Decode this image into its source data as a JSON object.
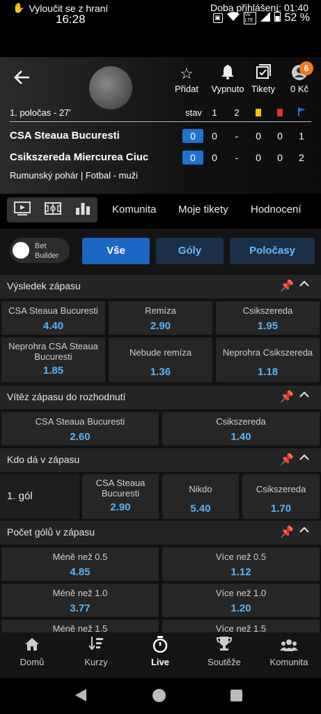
{
  "status_bar": {
    "time": "16:28",
    "battery": "52 %",
    "lte": "Vo LTE"
  },
  "info_bar": {
    "exclude": "Vyloučit se z hraní",
    "login_time": "Doba přihlášení: 01:40"
  },
  "header": {
    "actions": [
      {
        "icon": "star-icon",
        "label": "Přidat"
      },
      {
        "icon": "bell-icon",
        "label": "Vypnuto"
      },
      {
        "icon": "ticket-icon",
        "label": "Tikety"
      },
      {
        "icon": "account-icon",
        "label": "0 Kč"
      }
    ],
    "badge": "6",
    "phase": "1. poločas - 27'",
    "stats_headers": [
      "stav",
      "1",
      "2"
    ],
    "teams": [
      {
        "name": "CSA Steaua Bucuresti",
        "score": "0",
        "half1": "0",
        "dash": "-",
        "yellow": "0",
        "red": "0",
        "corners": "1"
      },
      {
        "name": "Csikszereda Miercurea Ciuc",
        "score": "0",
        "half1": "0",
        "dash": "-",
        "yellow": "0",
        "red": "0",
        "corners": "2"
      }
    ],
    "competition": "Rumunský pohár | Fotbal - muži"
  },
  "tabs": [
    "Komunita",
    "Moje tikety",
    "Hodnocení"
  ],
  "bet_builder": "Bet Builder",
  "filters": [
    "Vše",
    "Góly",
    "Poločasy"
  ],
  "sections": [
    {
      "title": "Výsledek zápasu",
      "odds": [
        {
          "label": "CSA Steaua Bucuresti",
          "value": "4.40"
        },
        {
          "label": "Remíza",
          "value": "2.90"
        },
        {
          "label": "Csikszereda",
          "value": "1.95"
        },
        {
          "label": "Neprohra CSA Steaua Bucuresti",
          "value": "1.85"
        },
        {
          "label": "Nebude remíza",
          "value": "1.36"
        },
        {
          "label": "Neprohra Csikszereda",
          "value": "1.18"
        }
      ]
    },
    {
      "title": "Vítěz zápasu do rozhodnutí",
      "odds": [
        {
          "label": "CSA Steaua Bucuresti",
          "value": "2.60"
        },
        {
          "label": "Csikszereda",
          "value": "1.40"
        }
      ]
    },
    {
      "title": "Kdo dá v zápasu",
      "row_label": "1. gól",
      "odds": [
        {
          "label": "CSA Steaua Bucuresti",
          "value": "2.90"
        },
        {
          "label": "Nikdo",
          "value": "5.40"
        },
        {
          "label": "Csikszereda",
          "value": "1.70"
        }
      ]
    },
    {
      "title": "Počet gólů v zápasu",
      "odds": [
        {
          "label": "Méně než 0.5",
          "value": "4.85"
        },
        {
          "label": "Více než 0.5",
          "value": "1.12"
        },
        {
          "label": "Méně než 1.0",
          "value": "3.77"
        },
        {
          "label": "Více než 1.0",
          "value": "1.20"
        },
        {
          "label": "Méně než 1.5",
          "value": ""
        },
        {
          "label": "Více než 1.5",
          "value": ""
        }
      ]
    }
  ],
  "bottom_nav": [
    {
      "icon": "home-icon",
      "label": "Domů",
      "active": false
    },
    {
      "icon": "odds-icon",
      "label": "Kurzy",
      "active": false
    },
    {
      "icon": "stopwatch-icon",
      "label": "Live",
      "active": true
    },
    {
      "icon": "trophy-icon",
      "label": "Soutěže",
      "active": false
    },
    {
      "icon": "community-icon",
      "label": "Komunita",
      "active": false
    }
  ],
  "colors": {
    "accent": "#1e73d2",
    "odds": "#5bb3f5",
    "badge": "#f07b1a",
    "yellow_card": "#f5c400",
    "red_card": "#e53030"
  }
}
